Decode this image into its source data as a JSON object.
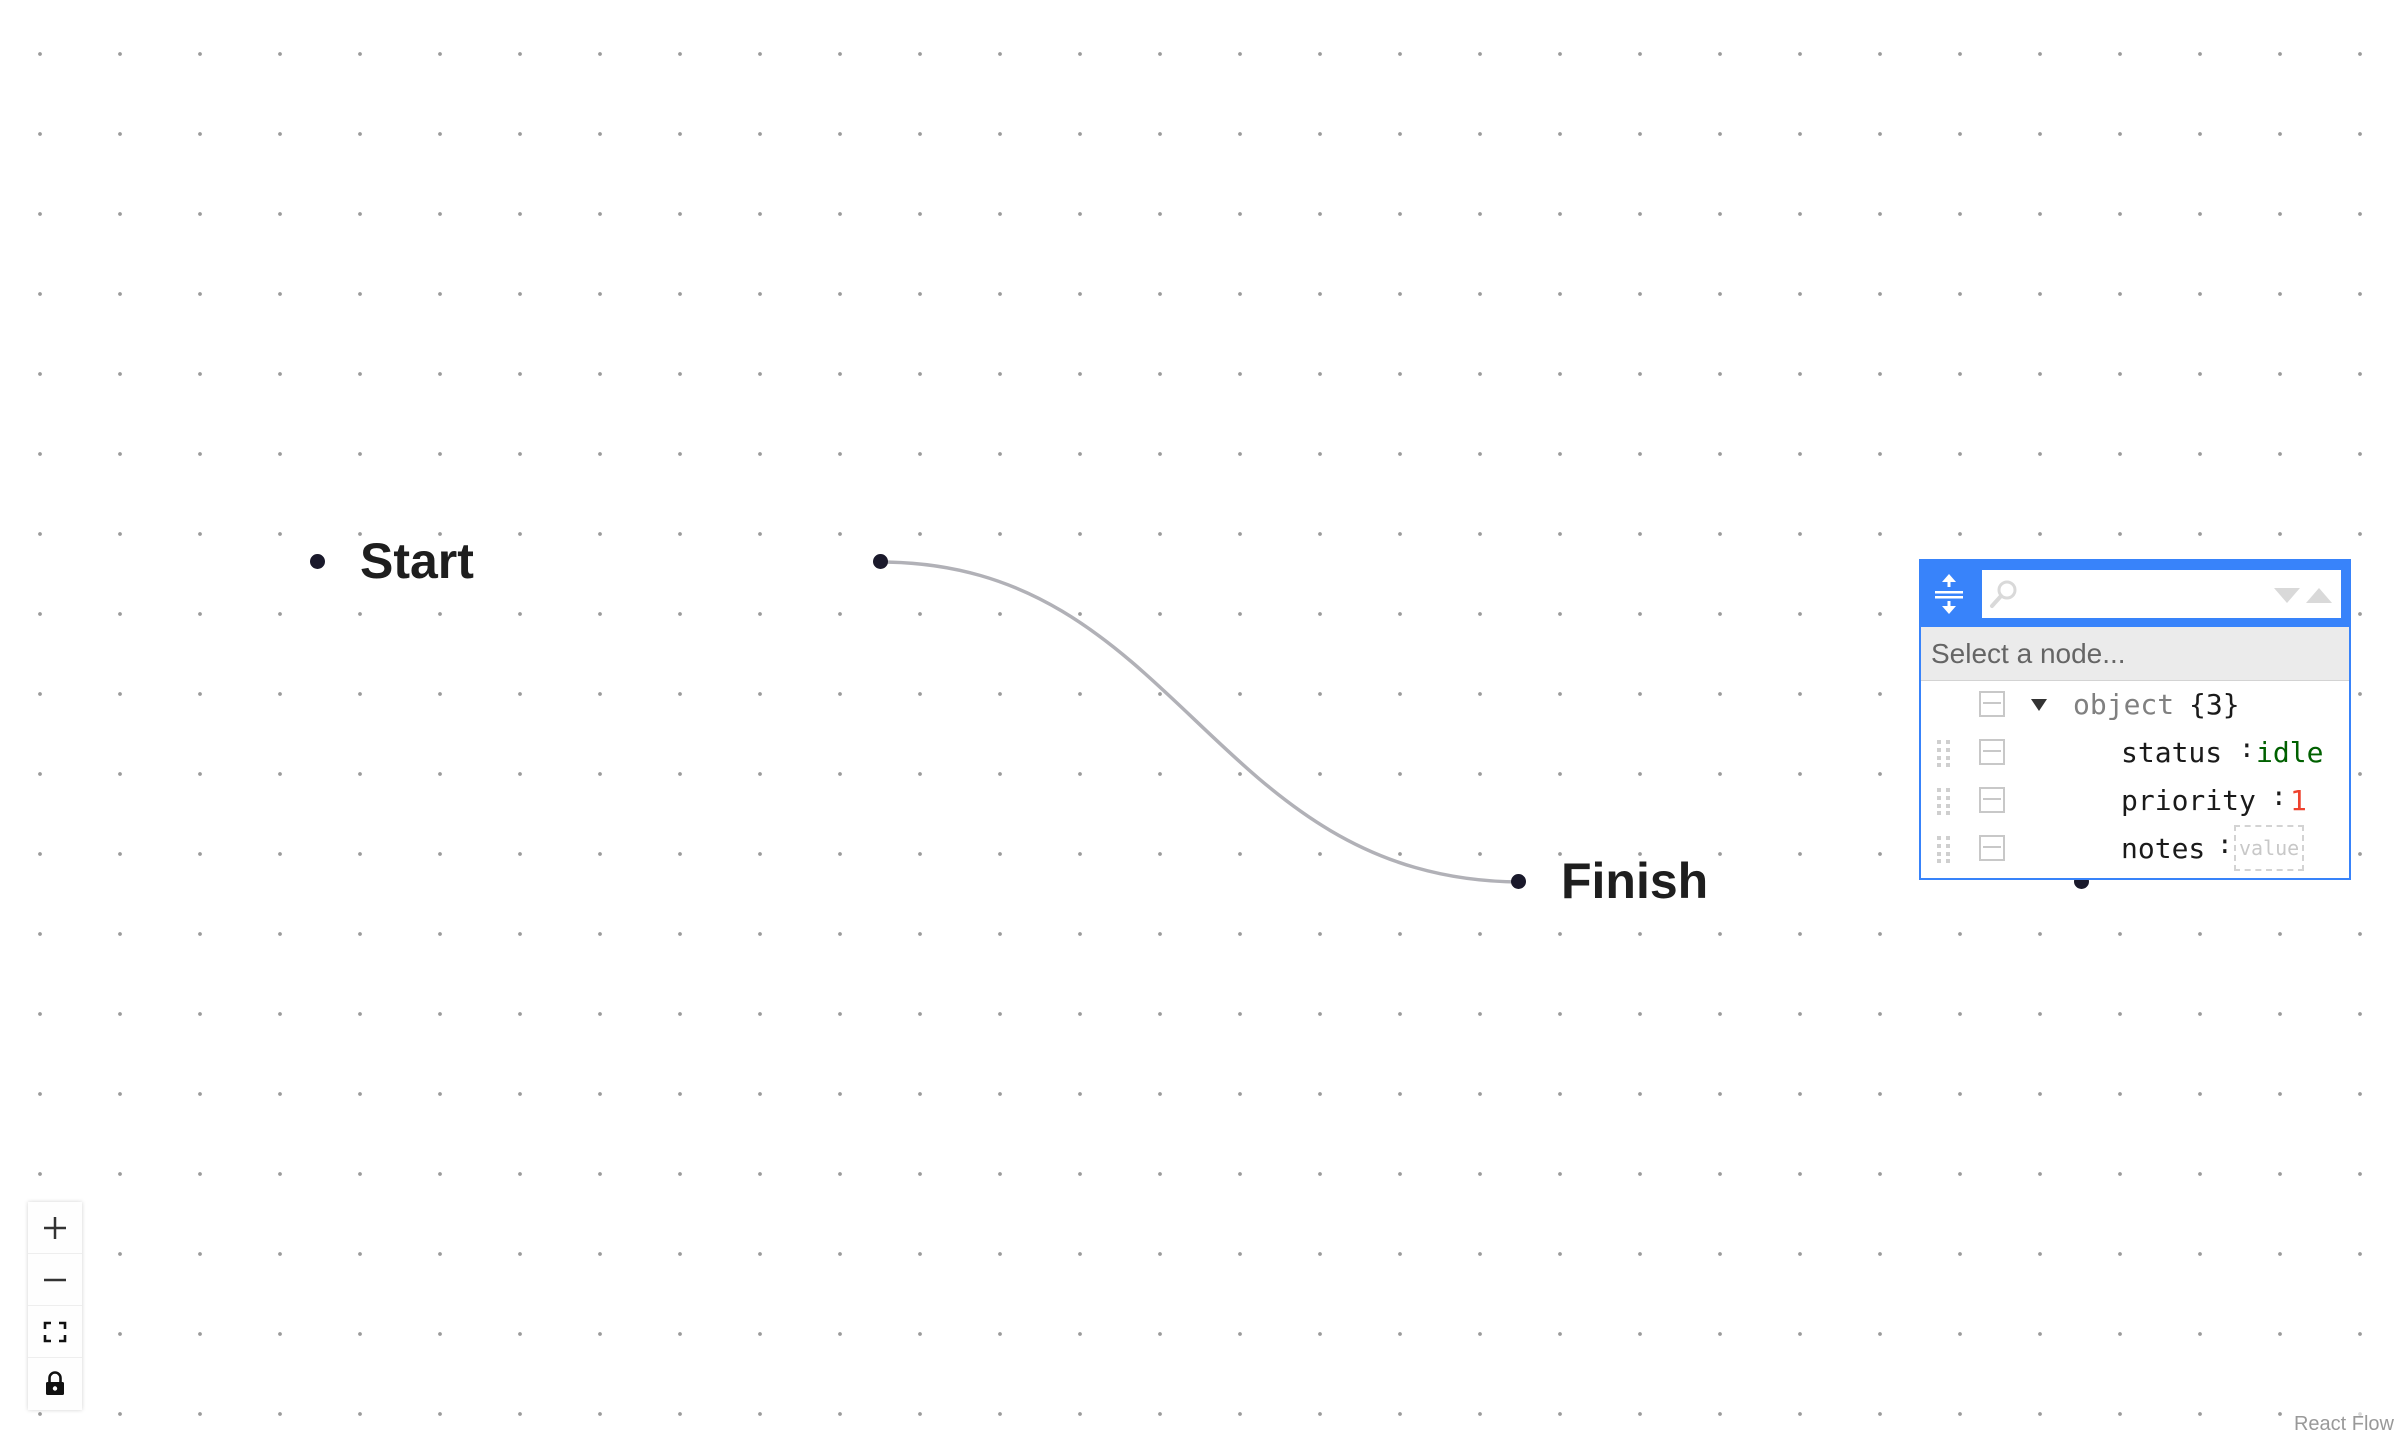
{
  "flow": {
    "nodes": [
      {
        "id": "start",
        "label": "Start"
      },
      {
        "id": "finish",
        "label": "Finish"
      }
    ],
    "edge_color": "#b1b1b7",
    "handle_color": "#1a192b"
  },
  "controls": {
    "zoom_in": "zoom-in",
    "zoom_out": "zoom-out",
    "fit_view": "fit-view",
    "lock": "lock"
  },
  "attribution": "React Flow",
  "json_editor": {
    "accent": "#3883fa",
    "search_placeholder": "",
    "navbar_text": "Select a node...",
    "root": {
      "type": "object",
      "count": "{3}"
    },
    "fields": [
      {
        "key": "status",
        "separator": ":",
        "value": "idle",
        "value_type": "string"
      },
      {
        "key": "priority",
        "separator": ":",
        "value": "1",
        "value_type": "number"
      },
      {
        "key": "notes",
        "separator": ":",
        "value": "value",
        "value_type": "empty"
      }
    ]
  }
}
